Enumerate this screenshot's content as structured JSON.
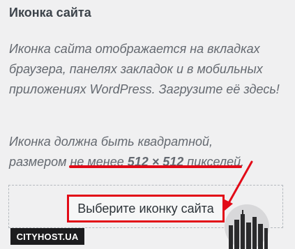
{
  "section": {
    "title": "Иконка сайта"
  },
  "description": {
    "paragraph1": "Иконка сайта отображается на вкладках браузера, панелях закладок и в мобильных приложениях WordPress. Загрузите её здесь!",
    "paragraph2_prefix": "Иконка должна быть квадратной,",
    "paragraph2_line2_prefix": "размером ",
    "paragraph2_highlight_pre": "не менее ",
    "paragraph2_highlight_bold": "512 × 512",
    "paragraph2_highlight_post": " пикселей",
    "paragraph2_suffix": "."
  },
  "upload": {
    "button_label": "Выберите иконку сайта"
  },
  "watermark": {
    "text": "CITYHOST.UA"
  },
  "colors": {
    "accent_red": "#e20a17",
    "text_heading": "#3c434a",
    "text_description": "#646970",
    "background": "#f0f0f1"
  }
}
